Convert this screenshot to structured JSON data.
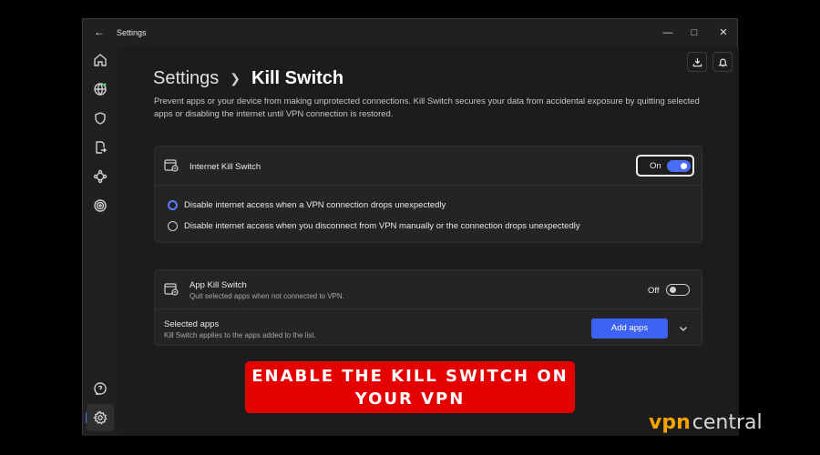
{
  "window": {
    "title": "Settings"
  },
  "breadcrumb": {
    "parent": "Settings",
    "current": "Kill Switch"
  },
  "description": "Prevent apps or your device from making unprotected connections. Kill Switch secures your data from accidental exposure by quitting selected apps or disabling the internet until VPN connection is restored.",
  "internet_kill_switch": {
    "label": "Internet Kill Switch",
    "toggle_label": "On",
    "options": [
      "Disable internet access when a VPN connection drops unexpectedly",
      "Disable internet access when you disconnect from VPN manually or the connection drops unexpectedly"
    ]
  },
  "app_kill_switch": {
    "label": "App Kill Switch",
    "sublabel": "Quit selected apps when not connected to VPN.",
    "toggle_label": "Off",
    "selected_apps_label": "Selected apps",
    "selected_apps_sub": "Kill Switch applies to the apps added to the list.",
    "add_button": "Add apps"
  },
  "banner": {
    "line1": "ENABLE THE KILL SWITCH ON",
    "line2": "YOUR VPN"
  },
  "logo": {
    "part1": "vpn",
    "part2": "central"
  },
  "colors": {
    "accent": "#4a6cf7",
    "banner": "#e50000",
    "logo_orange": "#f5a300"
  }
}
